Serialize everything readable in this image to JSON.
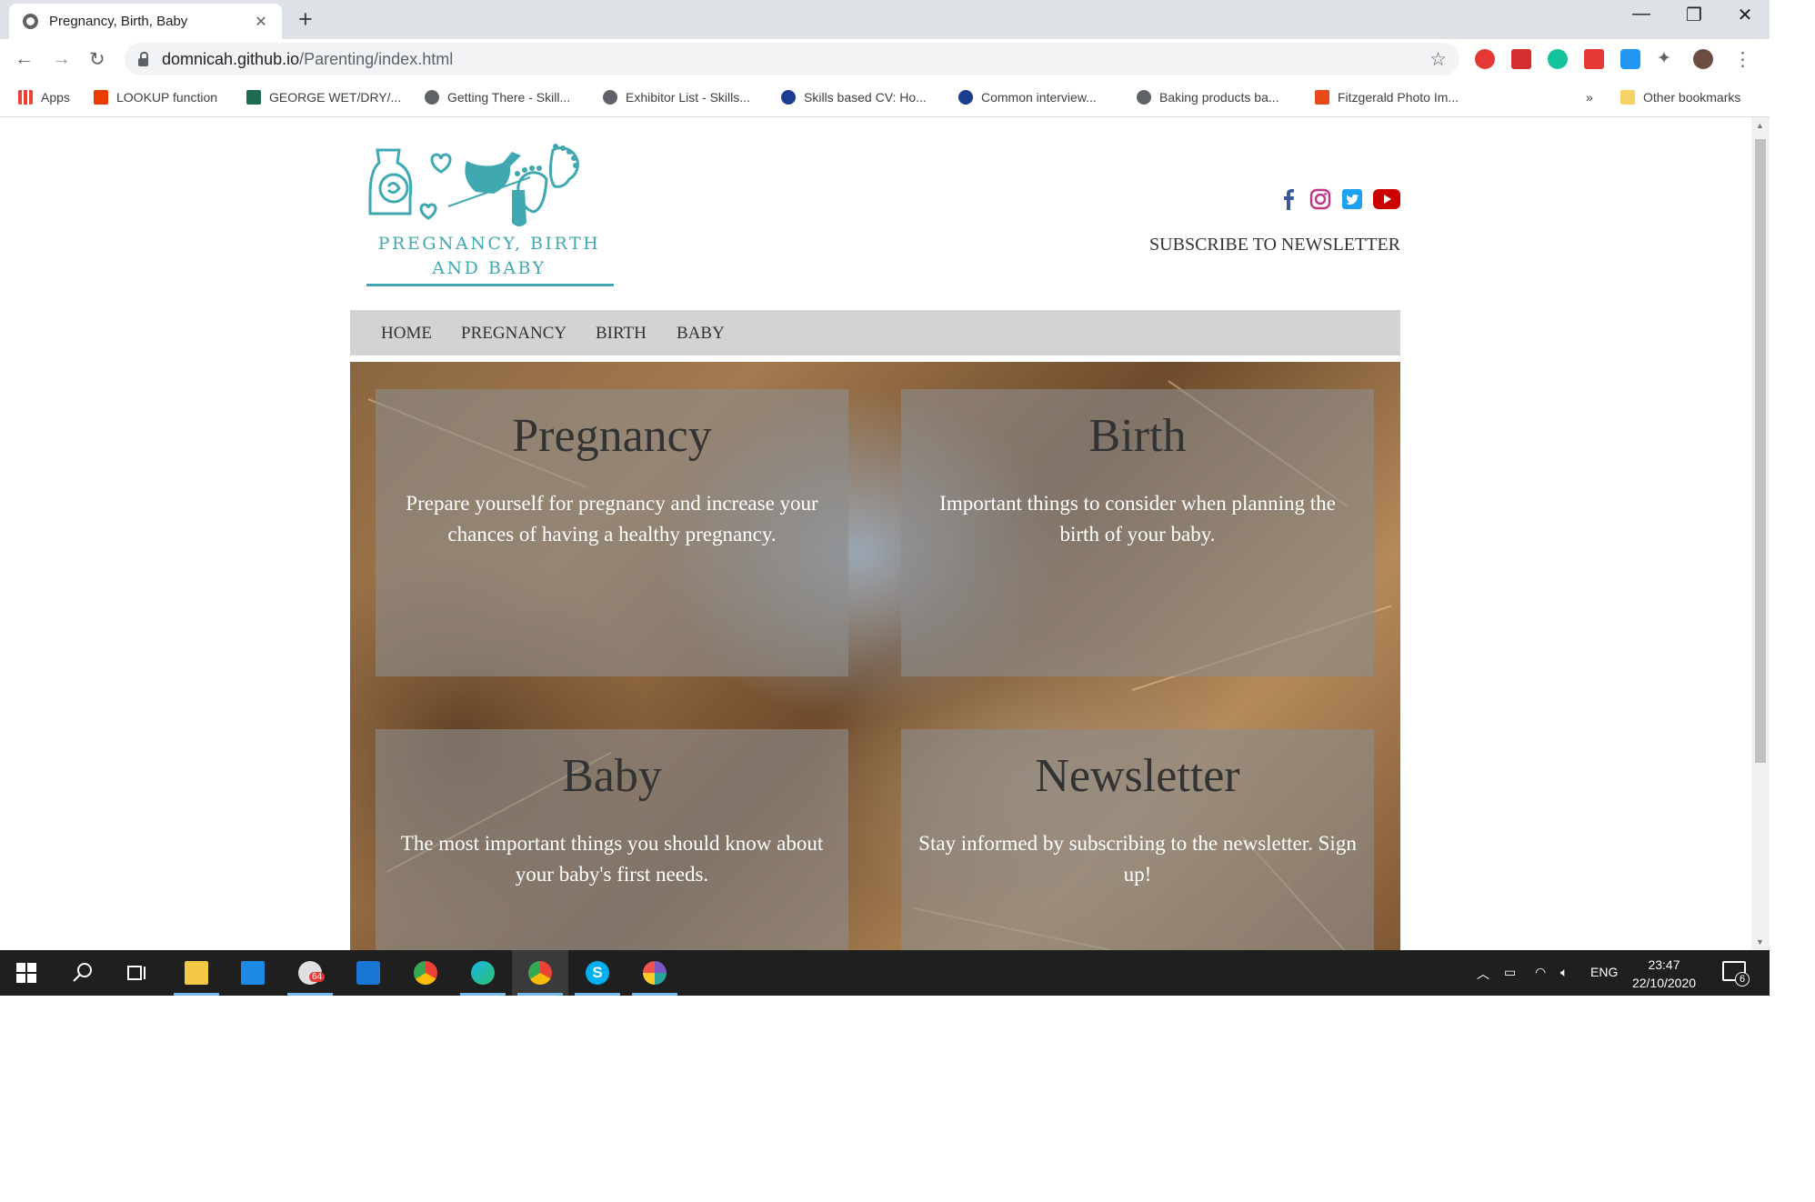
{
  "browser": {
    "tab_title": "Pregnancy, Birth, Baby",
    "tab_close": "✕",
    "new_tab": "+",
    "url_host": "domnicah.github.io",
    "url_path": "/Parenting/index.html",
    "window_controls": [
      "—",
      "❐",
      "✕"
    ],
    "bookmarks": [
      {
        "label": "Apps",
        "icon": "apps-grid-icon"
      },
      {
        "label": "LOOKUP function",
        "icon": "office-icon"
      },
      {
        "label": "GEORGE WET/DRY/...",
        "icon": "site-icon"
      },
      {
        "label": "Getting There - Skill...",
        "icon": "globe-icon"
      },
      {
        "label": "Exhibitor List - Skills...",
        "icon": "globe-icon"
      },
      {
        "label": "Skills based CV: Ho...",
        "icon": "site-icon"
      },
      {
        "label": "Common interview...",
        "icon": "site-icon"
      },
      {
        "label": "Baking products ba...",
        "icon": "globe-icon"
      },
      {
        "label": "Fitzgerald Photo Im...",
        "icon": "site-icon"
      }
    ],
    "bookmarks_overflow": "»",
    "other_bookmarks": "Other bookmarks"
  },
  "site": {
    "logo_line1": "PREGNANCY, BIRTH",
    "logo_line2": "AND BABY",
    "subscribe": "SUBSCRIBE TO NEWSLETTER",
    "nav": [
      "HOME",
      "PREGNANCY",
      "BIRTH",
      "BABY"
    ],
    "cards": [
      {
        "title": "Pregnancy",
        "text": "Prepare yourself for pregnancy and increase your chances of having a healthy pregnancy."
      },
      {
        "title": "Birth",
        "text": "Important things to consider when planning the birth of your baby."
      },
      {
        "title": "Baby",
        "text": "The most important things you should know about your baby's first needs."
      },
      {
        "title": "Newsletter",
        "text": "Stay informed by subscribing to the newsletter. Sign up!"
      }
    ],
    "colors": {
      "logo": "#3fa8b0",
      "facebook": "#3b5998",
      "instagram": "#c13584",
      "twitter": "#1da1f2",
      "youtube": "#cc0000"
    }
  },
  "taskbar": {
    "language": "ENG",
    "time": "23:47",
    "date": "22/10/2020",
    "notification_count": "6",
    "slack_badge": "64"
  }
}
